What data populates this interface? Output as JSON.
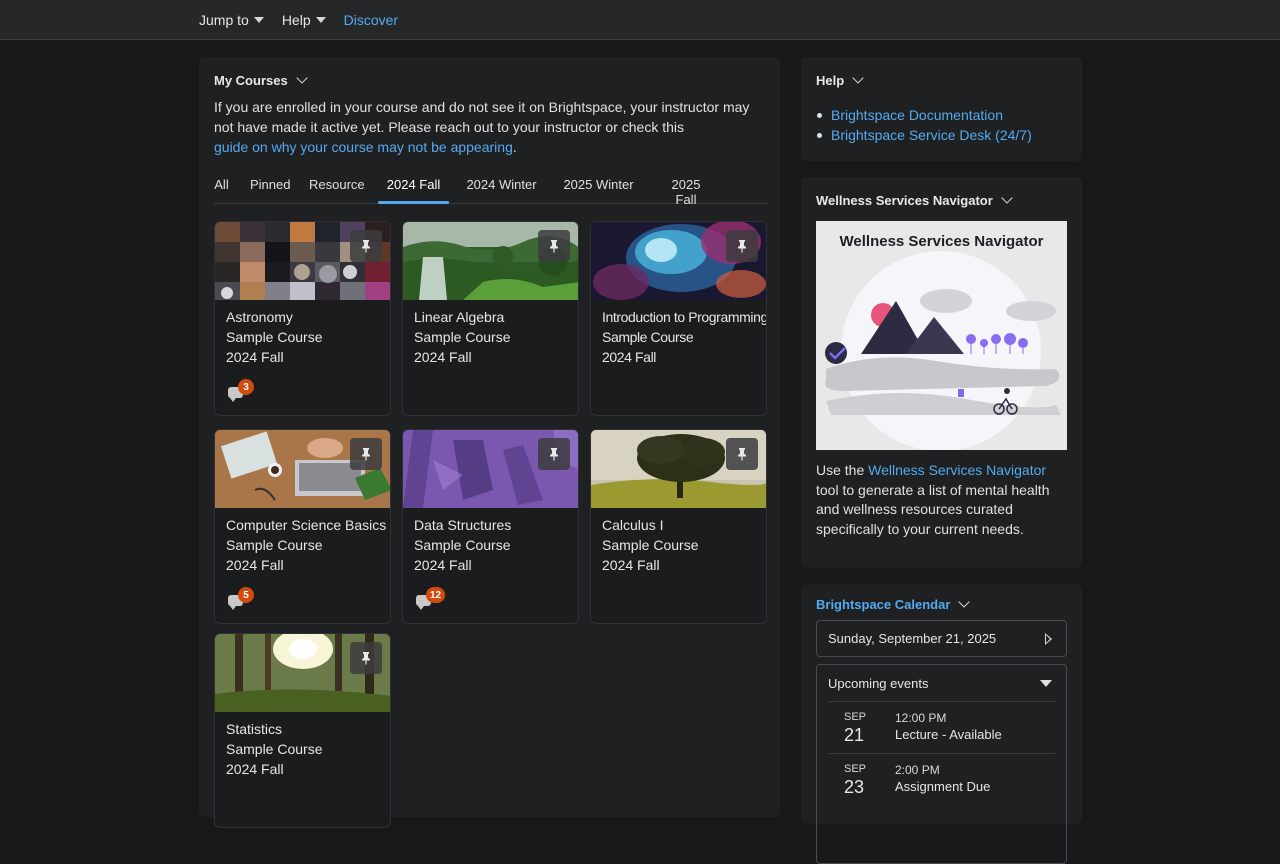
{
  "topnav": {
    "jump_to": "Jump to",
    "help": "Help",
    "discover": "Discover"
  },
  "my_courses": {
    "title": "My Courses",
    "intro_text": "If you are enrolled in your course and do not see it on Brightspace, your instructor may not have made it active yet. Please reach out to your instructor or check this",
    "intro_link": "guide on why your course may not be appearing",
    "intro_end": ".",
    "tabs": [
      {
        "label": "All"
      },
      {
        "label": "Pinned"
      },
      {
        "label": "Resource"
      },
      {
        "label": "2024 Fall",
        "active": true
      },
      {
        "label": "2024 Winter"
      },
      {
        "label": "2025 Winter"
      },
      {
        "label": "2025 Fall"
      }
    ],
    "courses": [
      {
        "name": "Astronomy",
        "type": "Sample Course",
        "term": "2024 Fall",
        "notifications": "3",
        "image": "astronomy-collage"
      },
      {
        "name": "Linear Algebra",
        "type": "Sample Course",
        "term": "2024 Fall",
        "image": "waterfall-forest"
      },
      {
        "name": "Introduction to Programming",
        "type": "Sample Course",
        "term": "2024 Fall",
        "image": "nebula"
      },
      {
        "name": "Computer Science Basics",
        "type": "Sample Course",
        "term": "2024 Fall",
        "notifications": "5",
        "image": "laptop-desk"
      },
      {
        "name": "Data Structures",
        "type": "Sample Course",
        "term": "2024 Fall",
        "notifications": "12",
        "image": "purple-pattern"
      },
      {
        "name": "Calculus I",
        "type": "Sample Course",
        "term": "2024 Fall",
        "image": "lone-tree"
      },
      {
        "name": "Statistics",
        "type": "Sample Course",
        "term": "2024 Fall",
        "image": "sunlit-forest"
      }
    ]
  },
  "help_panel": {
    "title": "Help",
    "links": [
      "Brightspace Documentation",
      "Brightspace Service Desk (24/7)"
    ]
  },
  "wellness": {
    "title": "Wellness Services Navigator",
    "image_title": "Wellness Services Navigator",
    "desc_before": "Use the ",
    "desc_link": "Wellness Services Navigator",
    "desc_after": " tool to generate a list of mental health and wellness resources curated specifically to your current needs."
  },
  "calendar": {
    "title": "Brightspace Calendar",
    "date": "Sunday, September 21, 2025",
    "upcoming_title": "Upcoming events",
    "events": [
      {
        "month": "SEP",
        "day": "21",
        "time": "12:00 PM",
        "name": "Lecture - Available"
      },
      {
        "month": "SEP",
        "day": "23",
        "time": "2:00 PM",
        "name": "Assignment Due"
      }
    ]
  },
  "colors": {
    "accent": "#54aaf0",
    "badge": "#d24a0e",
    "background": "#17181a",
    "panel": "#1f2022"
  }
}
